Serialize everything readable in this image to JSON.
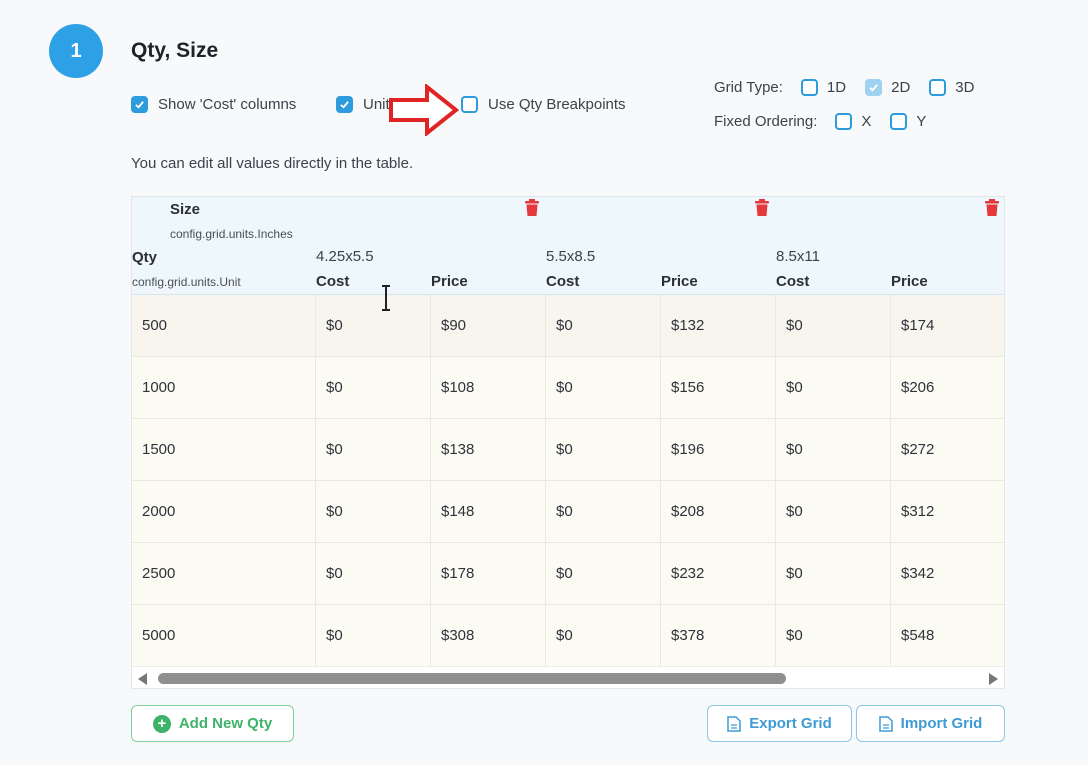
{
  "header": {
    "step_number": "1",
    "title": "Qty, Size"
  },
  "options": {
    "show_cost": {
      "label": "Show 'Cost' columns",
      "checked": true
    },
    "unit_price": {
      "label": "Unit Price",
      "checked": true
    },
    "use_qty_breakpoints": {
      "label": "Use Qty Breakpoints",
      "checked": false
    }
  },
  "grid_type": {
    "label": "Grid Type:",
    "options": [
      {
        "label": "1D",
        "checked": false
      },
      {
        "label": "2D",
        "checked": true
      },
      {
        "label": "3D",
        "checked": false
      }
    ]
  },
  "fixed_ordering": {
    "label": "Fixed Ordering:",
    "options": [
      {
        "label": "X",
        "checked": false
      },
      {
        "label": "Y",
        "checked": false
      }
    ]
  },
  "hint": "You can edit all values directly in the table.",
  "table": {
    "size_title": "Size",
    "size_unit": "config.grid.units.Inches",
    "qty_title": "Qty",
    "qty_unit": "config.grid.units.Unit",
    "sizes": [
      "4.25x5.5",
      "5.5x8.5",
      "8.5x11"
    ],
    "col_cost": "Cost",
    "col_price": "Price",
    "rows": [
      {
        "qty": "500",
        "cells": [
          "$0",
          "$90",
          "$0",
          "$132",
          "$0",
          "$174"
        ]
      },
      {
        "qty": "1000",
        "cells": [
          "$0",
          "$108",
          "$0",
          "$156",
          "$0",
          "$206"
        ]
      },
      {
        "qty": "1500",
        "cells": [
          "$0",
          "$138",
          "$0",
          "$196",
          "$0",
          "$272"
        ]
      },
      {
        "qty": "2000",
        "cells": [
          "$0",
          "$148",
          "$0",
          "$208",
          "$0",
          "$312"
        ]
      },
      {
        "qty": "2500",
        "cells": [
          "$0",
          "$178",
          "$0",
          "$232",
          "$0",
          "$342"
        ]
      },
      {
        "qty": "5000",
        "cells": [
          "$0",
          "$308",
          "$0",
          "$378",
          "$0",
          "$548"
        ]
      }
    ]
  },
  "buttons": {
    "add_qty": "Add New Qty",
    "export_grid": "Export Grid",
    "import_grid": "Import Grid"
  },
  "icons": {
    "trash": "trash-icon",
    "annotation_arrow": "arrow-right-icon",
    "plus": "plus-circle-icon",
    "document": "document-icon"
  },
  "colors": {
    "accent": "#2e9bdc",
    "add_green": "#3fb26a",
    "trash_red": "#e5383b",
    "arrow_red": "#e02424"
  }
}
